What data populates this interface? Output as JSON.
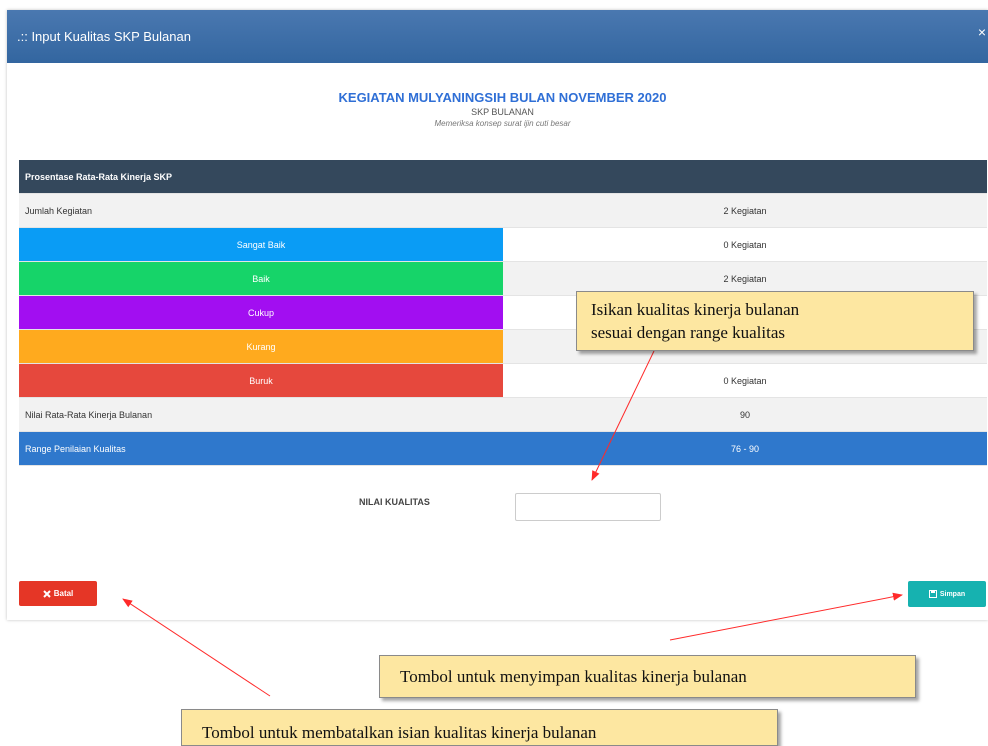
{
  "modal": {
    "title": ".:: Input Kualitas SKP Bulanan",
    "close": "×"
  },
  "info": {
    "title": "KEGIATAN MULYANINGSIH BULAN NOVEMBER 2020",
    "subtitle": "SKP BULANAN",
    "description": "Memeriksa konsep surat ijin cuti besar"
  },
  "table": {
    "header": "Prosentase Rata-Rata Kinerja SKP",
    "jumlah_label": "Jumlah Kegiatan",
    "jumlah_value": "2 Kegiatan",
    "categories": [
      {
        "label": "Sangat Baik",
        "value": "0 Kegiatan"
      },
      {
        "label": "Baik",
        "value": "2 Kegiatan"
      },
      {
        "label": "Cukup",
        "value": ""
      },
      {
        "label": "Kurang",
        "value": ""
      },
      {
        "label": "Buruk",
        "value": "0 Kegiatan"
      }
    ],
    "rata_label": "Nilai Rata-Rata Kinerja Bulanan",
    "rata_value": "90",
    "range_label": "Range Penilaian Kualitas",
    "range_value": "76 - 90"
  },
  "form": {
    "nilai_label": "NILAI KUALITAS",
    "nilai_value": ""
  },
  "buttons": {
    "batal": "Batal",
    "simpan": "Simpan"
  },
  "callouts": {
    "input_line1": "Isikan kualitas kinerja bulanan",
    "input_line2": "sesuai dengan range kualitas",
    "simpan_note": "Tombol untuk menyimpan kualitas kinerja bulanan",
    "batal_note": "Tombol untuk membatalkan isian kualitas kinerja bulanan"
  },
  "colors": {
    "header": "#3a6ea8",
    "sangat_baik": "#0a9cf5",
    "baik": "#16d469",
    "cukup": "#a20ef1",
    "kurang": "#ffaa1e",
    "buruk": "#e6483d",
    "range": "#2f78cc",
    "batal": "#e53626",
    "simpan": "#16b2b0",
    "callout": "#fde7a1",
    "arrow": "#ff2a2a"
  },
  "icons": {
    "batal": "close-icon",
    "simpan": "save-icon"
  }
}
